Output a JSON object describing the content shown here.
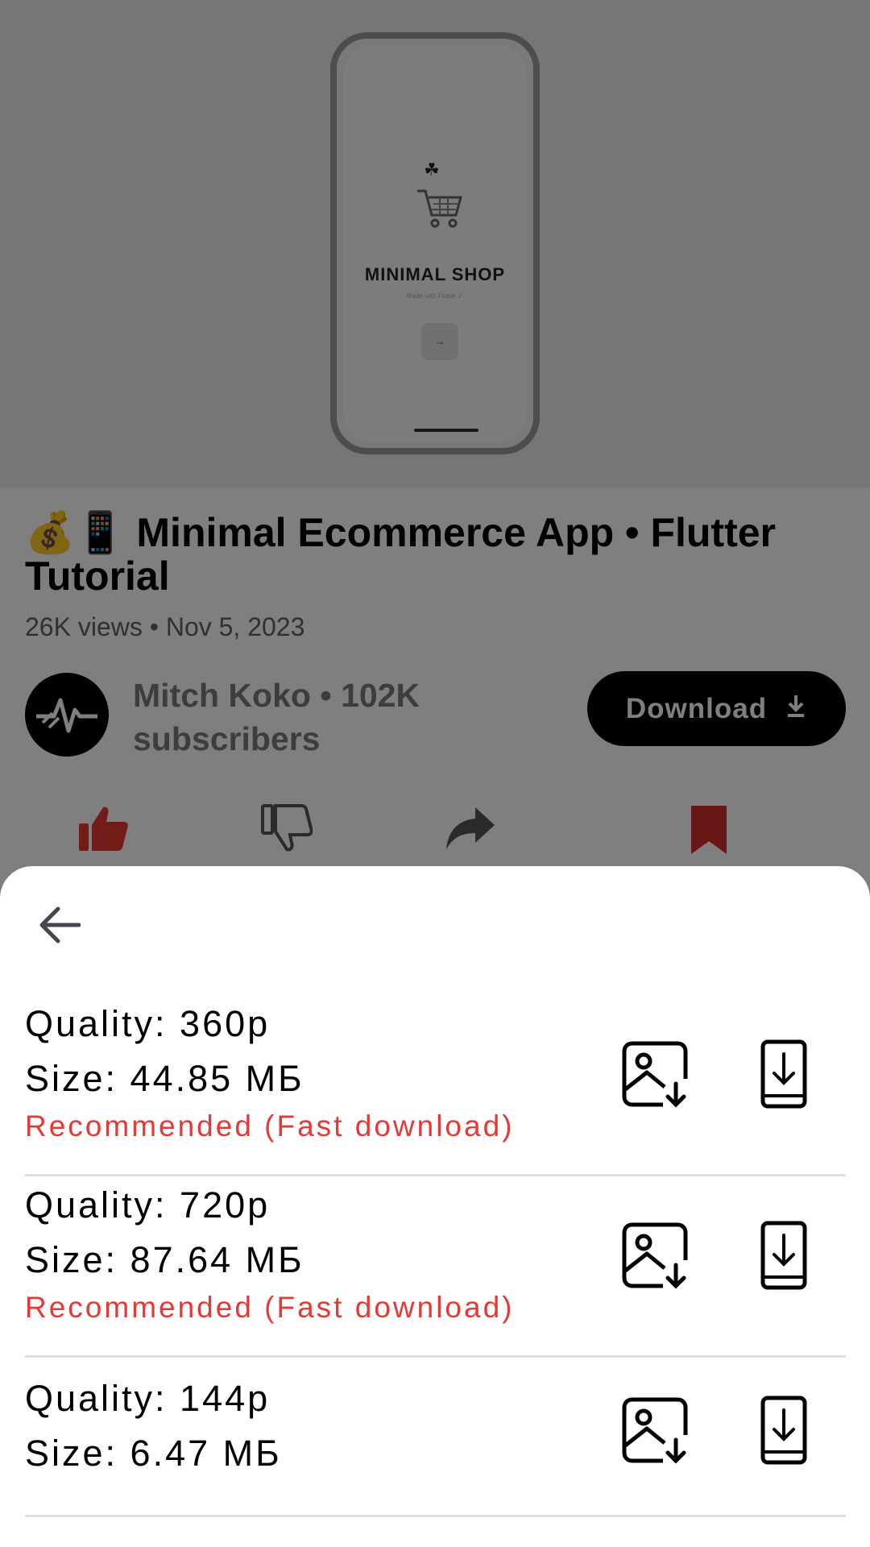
{
  "video": {
    "thumbnail": {
      "shop_title": "MINIMAL SHOP",
      "shop_subtitle": "Made with Flutter ✓"
    },
    "title": "💰📱 Minimal Ecommerce App • Flutter Tutorial",
    "meta": "26K views • Nov 5, 2023",
    "channel": "Mitch Koko • 102K subscribers",
    "download_label": "Download"
  },
  "actions": {
    "like_icon": "thumbs-up-icon",
    "dislike_icon": "thumbs-down-icon",
    "share_icon": "share-icon",
    "save_icon": "bookmark-icon",
    "colors": {
      "like": "#e53935",
      "save": "#d32f2f"
    }
  },
  "sheet": {
    "back_icon": "arrow-left-icon",
    "options": [
      {
        "quality": "Quality: 360p",
        "size": "Size: 44.85 МБ",
        "note": "Recommended (Fast download)"
      },
      {
        "quality": "Quality: 720p",
        "size": "Size: 87.64 МБ",
        "note": "Recommended (Fast download)"
      },
      {
        "quality": "Quality: 144p",
        "size": "Size: 6.47 МБ",
        "note": ""
      }
    ],
    "row_icons": [
      "save-to-gallery-icon",
      "download-to-device-icon"
    ],
    "accent": "#e53935"
  }
}
